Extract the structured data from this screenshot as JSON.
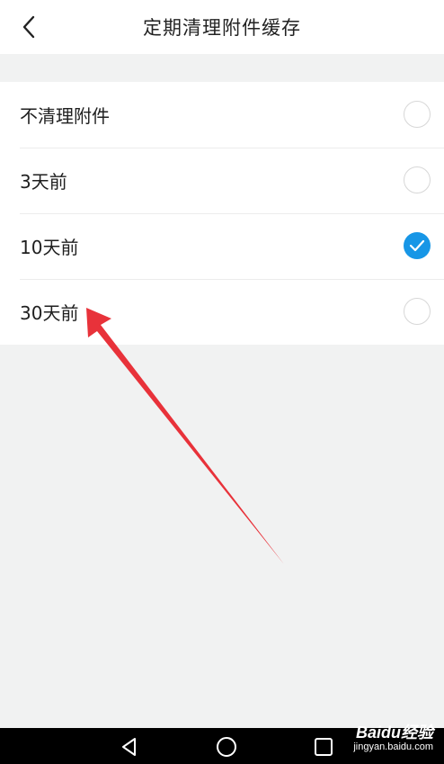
{
  "header": {
    "title": "定期清理附件缓存",
    "back_icon": "chevron-left-icon"
  },
  "options": [
    {
      "label": "不清理附件",
      "selected": false
    },
    {
      "label": "3天前",
      "selected": false
    },
    {
      "label": "10天前",
      "selected": true
    },
    {
      "label": "30天前",
      "selected": false
    }
  ],
  "colors": {
    "accent": "#1796e6",
    "annotation_arrow": "#e8323a",
    "background": "#f1f2f2"
  },
  "navbar": {
    "icons": [
      "triangle-back-icon",
      "circle-home-icon",
      "square-recent-icon"
    ]
  },
  "watermark": {
    "brand": "Baidu经验",
    "url": "jingyan.baidu.com"
  }
}
